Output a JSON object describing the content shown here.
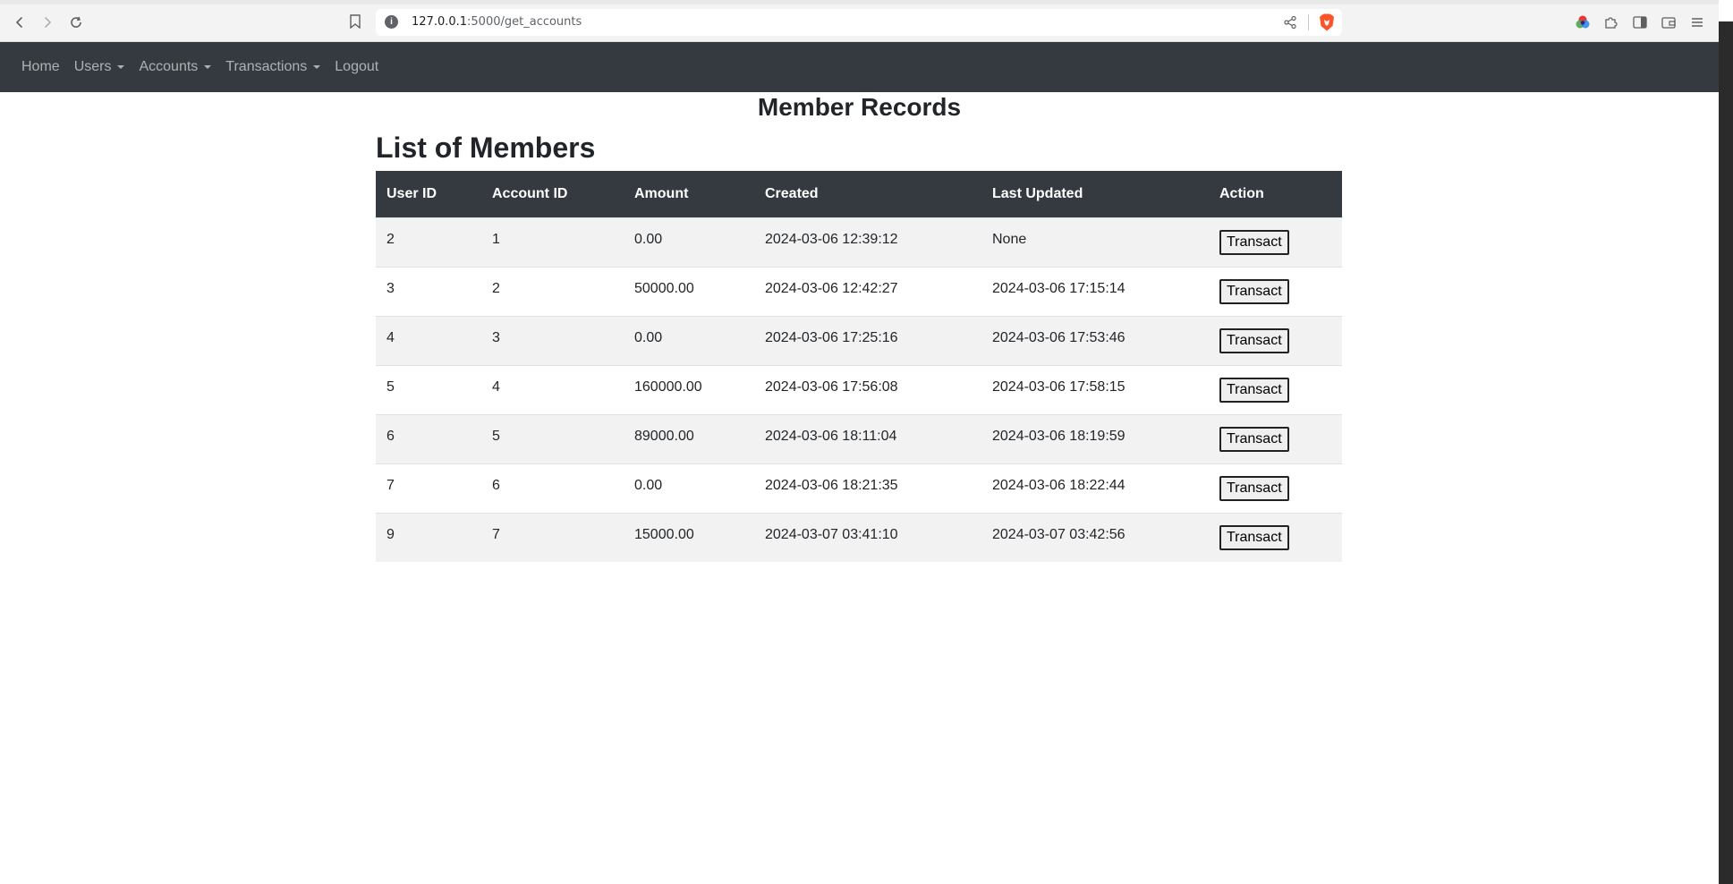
{
  "browser": {
    "url_host": "127.0.0.1",
    "url_path": ":5000/get_accounts",
    "info_icon": "info-icon",
    "icons": [
      "back-arrow-icon",
      "forward-arrow-icon",
      "reload-icon",
      "bookmark-icon",
      "share-icon",
      "brave-lion-icon",
      "color-wheel-icon",
      "extensions-puzzle-icon",
      "sidebar-icon",
      "wallet-icon",
      "menu-icon"
    ]
  },
  "navbar": {
    "background": "#343a40",
    "items": [
      {
        "label": "Home",
        "dropdown": false
      },
      {
        "label": "Users",
        "dropdown": true
      },
      {
        "label": "Accounts",
        "dropdown": true
      },
      {
        "label": "Transactions",
        "dropdown": true
      },
      {
        "label": "Logout",
        "dropdown": false
      }
    ]
  },
  "page": {
    "title": "Member Records",
    "section_title": "List of Members"
  },
  "table": {
    "headers": [
      "User ID",
      "Account ID",
      "Amount",
      "Created",
      "Last Updated",
      "Action"
    ],
    "rows": [
      {
        "user_id": "2",
        "account_id": "1",
        "amount": "0.00",
        "created": "2024-03-06 12:39:12",
        "last_updated": "None",
        "action": "Transact"
      },
      {
        "user_id": "3",
        "account_id": "2",
        "amount": "50000.00",
        "created": "2024-03-06 12:42:27",
        "last_updated": "2024-03-06 17:15:14",
        "action": "Transact"
      },
      {
        "user_id": "4",
        "account_id": "3",
        "amount": "0.00",
        "created": "2024-03-06 17:25:16",
        "last_updated": "2024-03-06 17:53:46",
        "action": "Transact"
      },
      {
        "user_id": "5",
        "account_id": "4",
        "amount": "160000.00",
        "created": "2024-03-06 17:56:08",
        "last_updated": "2024-03-06 17:58:15",
        "action": "Transact"
      },
      {
        "user_id": "6",
        "account_id": "5",
        "amount": "89000.00",
        "created": "2024-03-06 18:11:04",
        "last_updated": "2024-03-06 18:19:59",
        "action": "Transact"
      },
      {
        "user_id": "7",
        "account_id": "6",
        "amount": "0.00",
        "created": "2024-03-06 18:21:35",
        "last_updated": "2024-03-06 18:22:44",
        "action": "Transact"
      },
      {
        "user_id": "9",
        "account_id": "7",
        "amount": "15000.00",
        "created": "2024-03-07 03:41:10",
        "last_updated": "2024-03-07 03:42:56",
        "action": "Transact"
      }
    ]
  }
}
